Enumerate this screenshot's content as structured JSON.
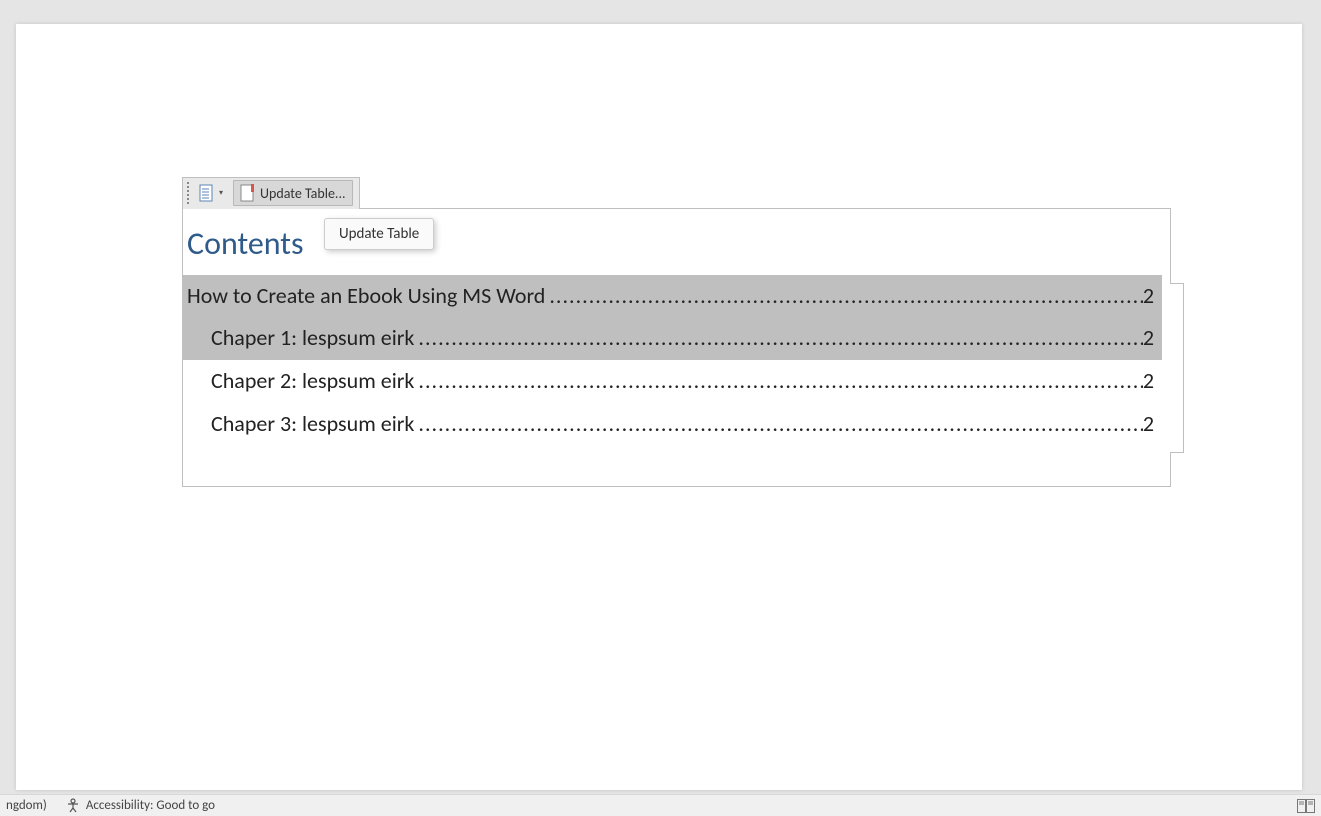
{
  "toolbar": {
    "update_button_label": "Update Table...",
    "tooltip_text": "Update Table"
  },
  "toc": {
    "title": "Contents",
    "entries": [
      {
        "text": "How to Create an Ebook Using MS Word",
        "page": "2",
        "level": 1,
        "selected": true
      },
      {
        "text": "Chaper 1: lespsum eirk",
        "page": "2",
        "level": 2,
        "selected": true
      },
      {
        "text": "Chaper 2: lespsum eirk",
        "page": "2",
        "level": 2,
        "selected": false
      },
      {
        "text": "Chaper 3: lespsum eirk",
        "page": "2",
        "level": 2,
        "selected": false
      }
    ]
  },
  "statusbar": {
    "language_fragment": "ngdom)",
    "accessibility": "Accessibility: Good to go"
  }
}
